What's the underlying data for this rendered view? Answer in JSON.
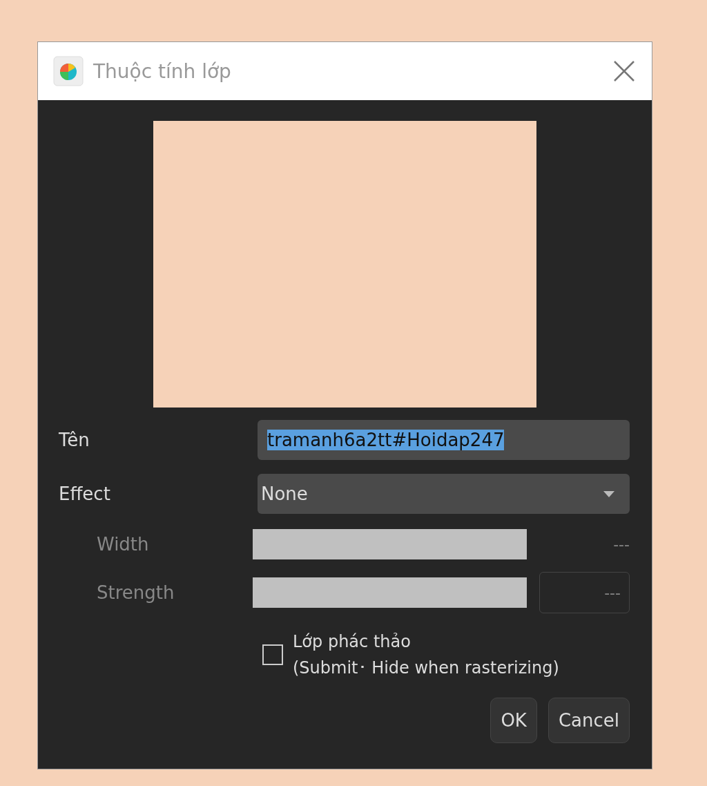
{
  "window": {
    "title": "Thuộc tính lớp"
  },
  "name_field": {
    "label": "Tên",
    "value": "tramanh6a2tt#Hoidap247",
    "text_selected": true
  },
  "effect": {
    "label": "Effect",
    "value": "None"
  },
  "sliders": [
    {
      "label": "Width",
      "reading": "---",
      "disabled": true,
      "kind": "plain"
    },
    {
      "label": "Strength",
      "reading": "---",
      "disabled": true,
      "kind": "boxed"
    }
  ],
  "draft_checkbox": {
    "label": "Lớp phác thảo",
    "sublabel": "(Submit･ Hide when rasterizing)",
    "checked": false
  },
  "buttons": [
    "OK",
    "Cancel"
  ]
}
